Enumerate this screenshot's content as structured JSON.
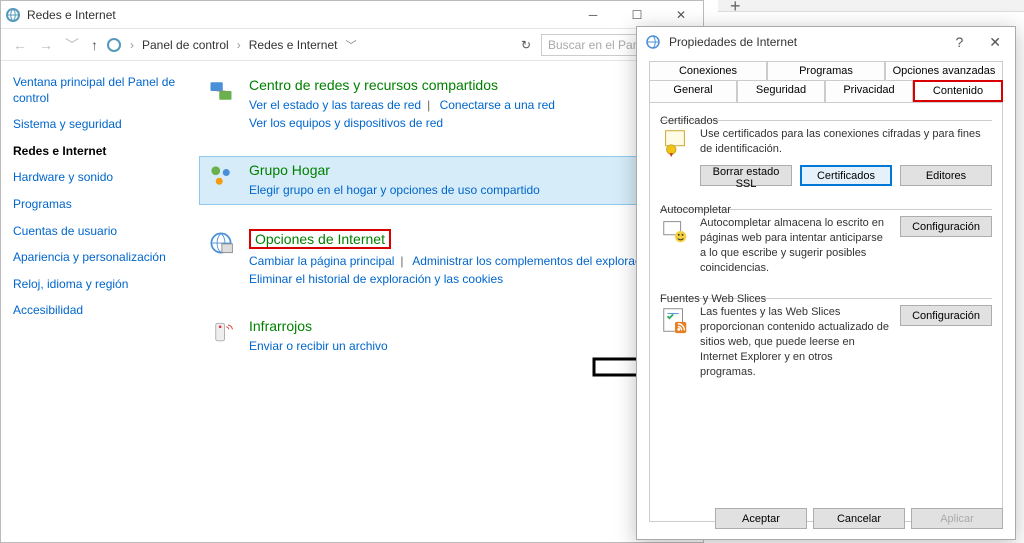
{
  "cp": {
    "title": "Redes e Internet",
    "breadcrumb": {
      "root": "Panel de control",
      "current": "Redes e Internet"
    },
    "searchPlaceholder": "Buscar en el Panel de",
    "side": [
      "Ventana principal del Panel de control",
      "Sistema y seguridad",
      "Redes e Internet",
      "Hardware y sonido",
      "Programas",
      "Cuentas de usuario",
      "Apariencia y personalización",
      "Reloj, idioma y región",
      "Accesibilidad"
    ],
    "cats": [
      {
        "title": "Centro de redes y recursos compartidos",
        "links": [
          "Ver el estado y las tareas de red",
          "Conectarse a una red",
          "Ver los equipos y dispositivos de red"
        ]
      },
      {
        "title": "Grupo Hogar",
        "links": [
          "Elegir grupo en el hogar y opciones de uso compartido"
        ]
      },
      {
        "title": "Opciones de Internet",
        "links": [
          "Cambiar la página principal",
          "Administrar los complementos del explorador",
          "Eliminar el historial de exploración y las cookies"
        ]
      },
      {
        "title": "Infrarrojos",
        "links": [
          "Enviar o recibir un archivo"
        ]
      }
    ]
  },
  "ip": {
    "title": "Propiedades de Internet",
    "tabsTop": [
      "Conexiones",
      "Programas",
      "Opciones avanzadas"
    ],
    "tabsBot": [
      "General",
      "Seguridad",
      "Privacidad",
      "Contenido"
    ],
    "cert": {
      "label": "Certificados",
      "text": "Use certificados para las conexiones cifradas y para fines de identificación.",
      "btn1": "Borrar estado SSL",
      "btn2": "Certificados",
      "btn3": "Editores"
    },
    "auto": {
      "label": "Autocompletar",
      "text": "Autocompletar almacena lo escrito en páginas web para intentar anticiparse a lo que escribe y sugerir posibles coincidencias.",
      "btn": "Configuración"
    },
    "feeds": {
      "label": "Fuentes y Web Slices",
      "text": "Las fuentes y las Web Slices proporcionan contenido actualizado de sitios web, que puede leerse en Internet Explorer y en otros programas.",
      "btn": "Configuración"
    },
    "footer": {
      "ok": "Aceptar",
      "cancel": "Cancelar",
      "apply": "Aplicar"
    }
  }
}
